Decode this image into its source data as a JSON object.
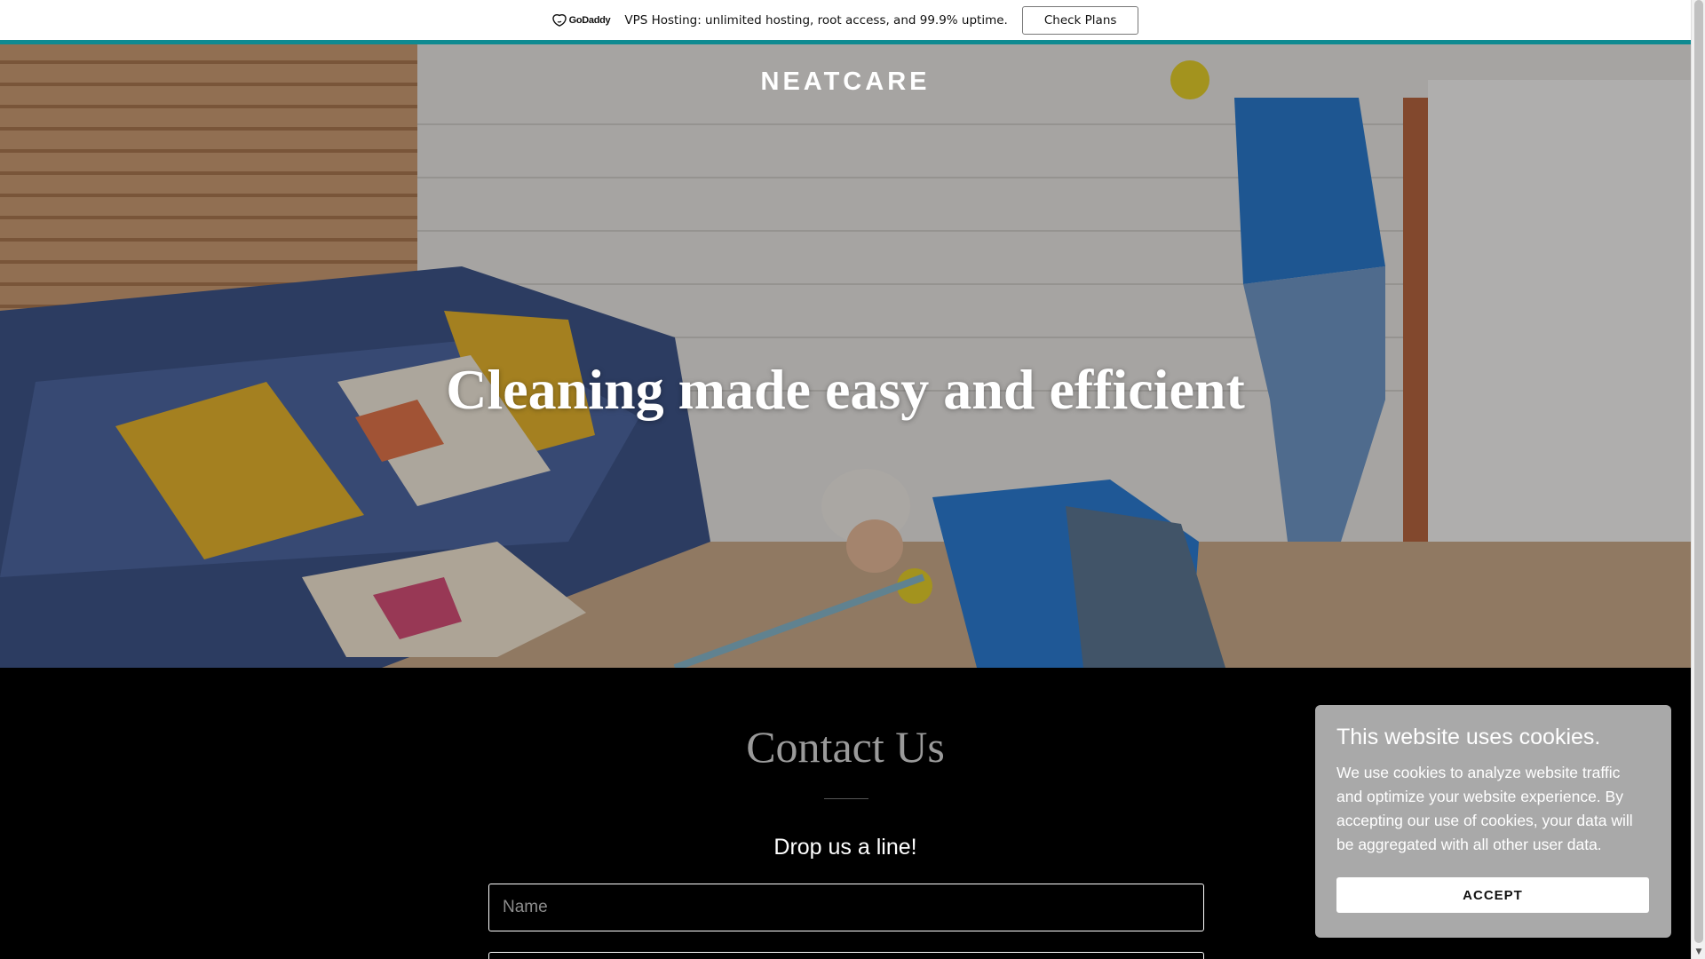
{
  "promo": {
    "brand": "GoDaddy",
    "logo_icon": "godaddy-logo-icon",
    "message": "VPS Hosting: unlimited hosting, root access, and 99.9% uptime.",
    "cta_label": "Check Plans",
    "border_color": "#0e8a91"
  },
  "header": {
    "brand": "NEATCARE"
  },
  "hero": {
    "headline": "Cleaning made easy and efficient"
  },
  "contact": {
    "title": "Contact Us",
    "subtitle": "Drop us a line!",
    "name_placeholder": "Name",
    "email_placeholder": ""
  },
  "cookie_banner": {
    "title": "This website uses cookies.",
    "body": "We use cookies to analyze website traffic and optimize your website experience. By accepting our use of cookies, your data will be aggregated with all other user data.",
    "accept_label": "ACCEPT"
  }
}
